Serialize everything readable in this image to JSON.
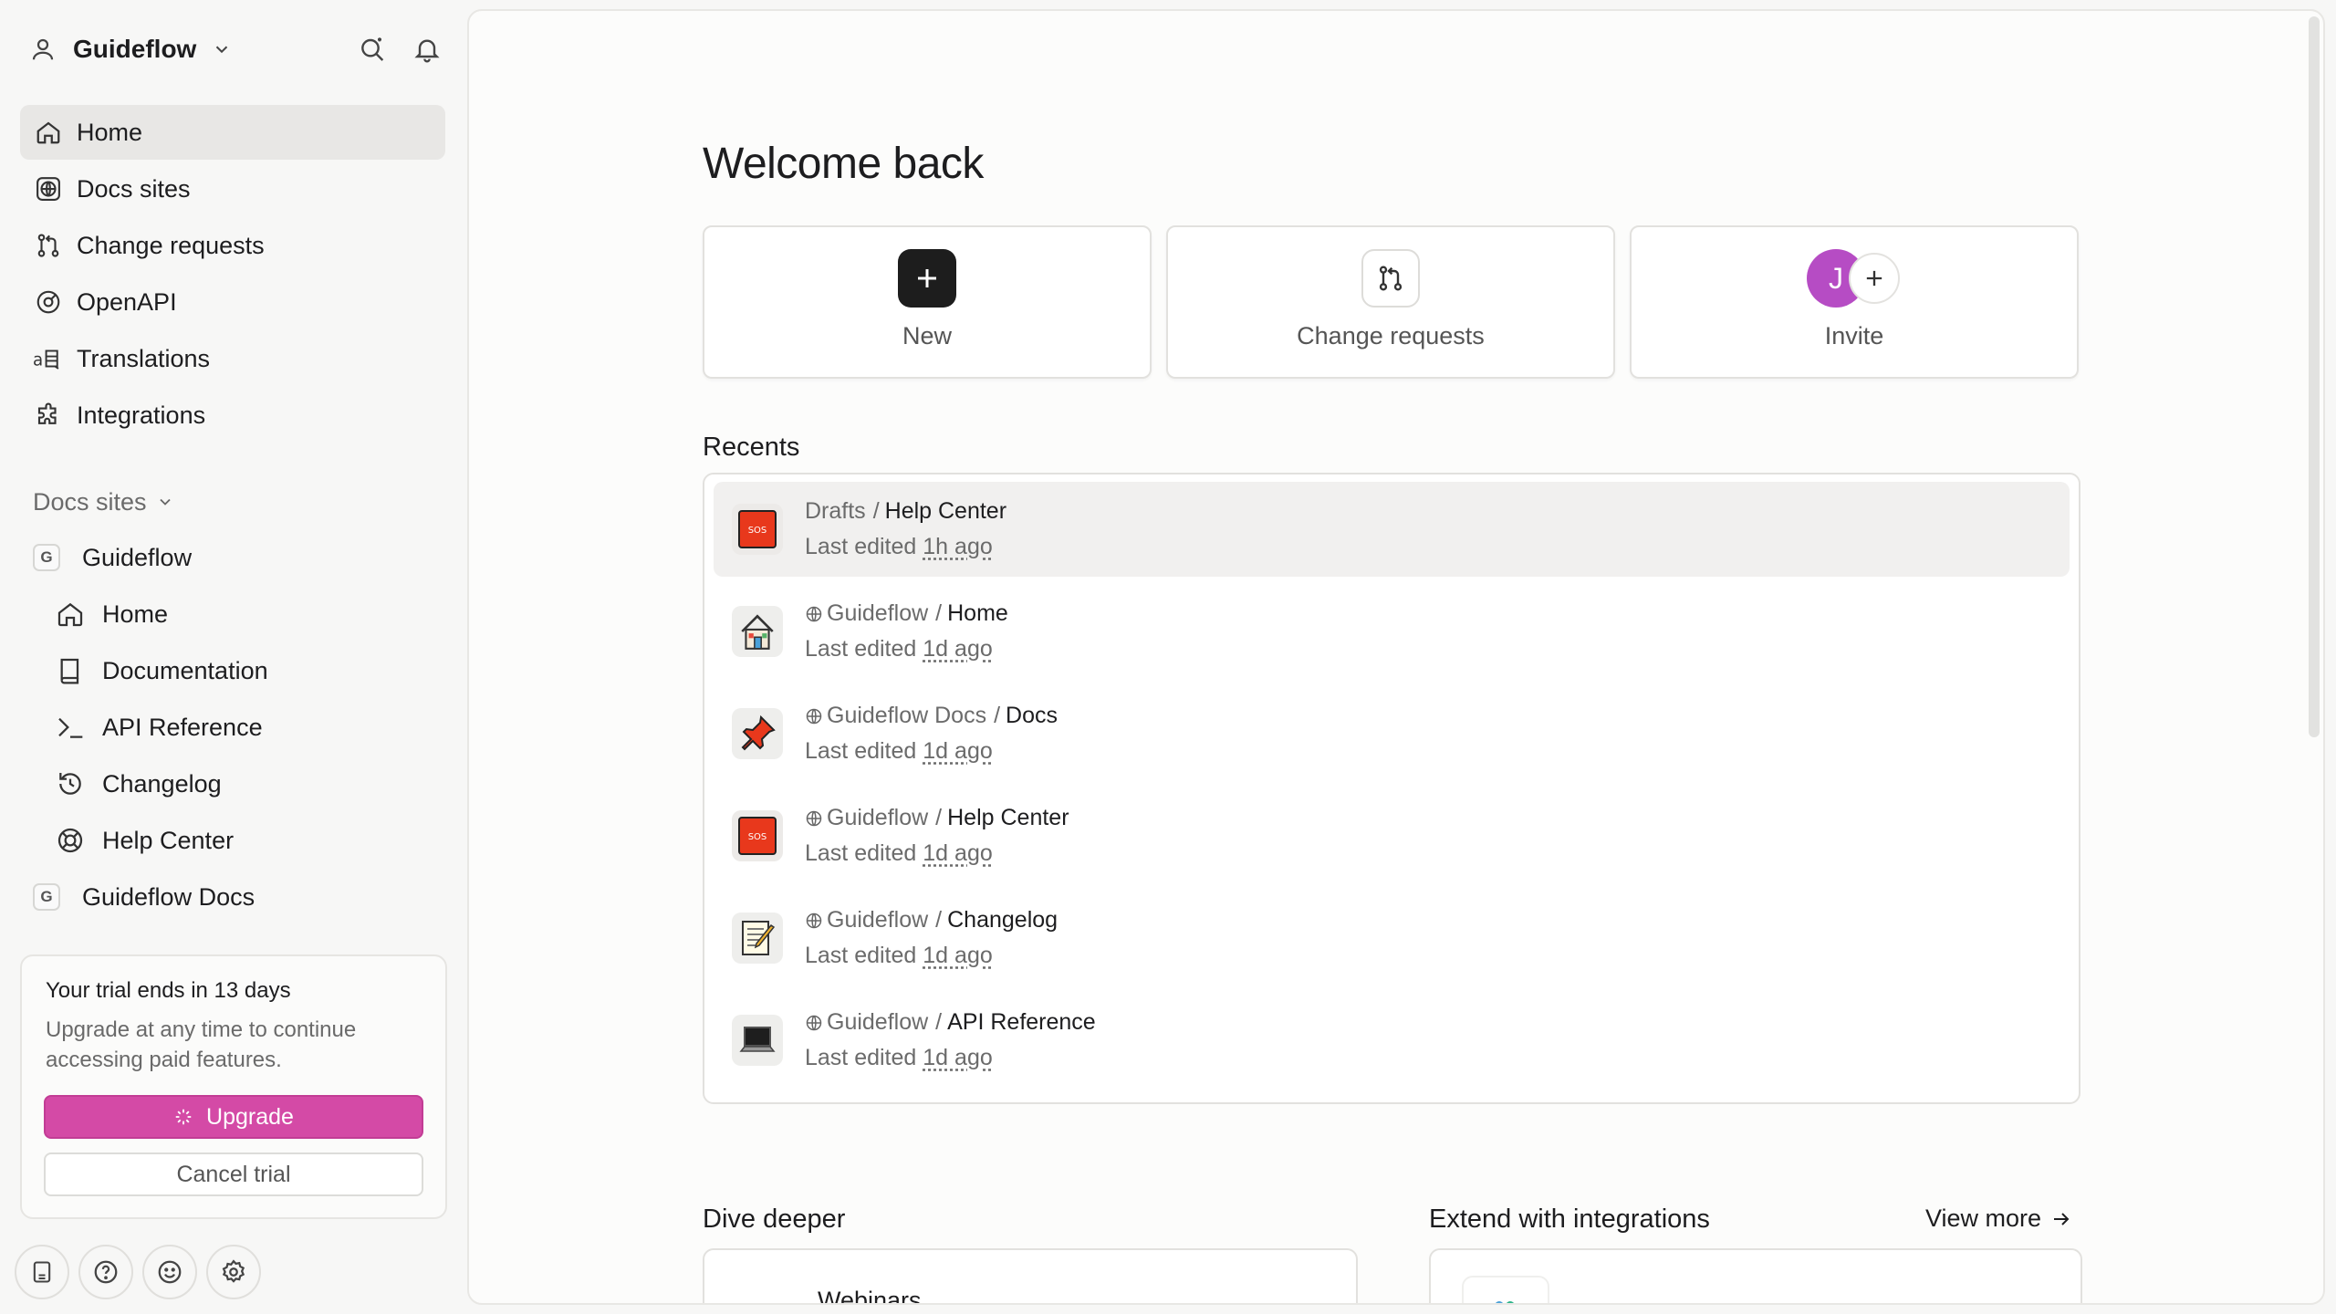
{
  "workspace": {
    "name": "Guideflow"
  },
  "nav": [
    {
      "label": "Home",
      "icon": "home-icon",
      "active": true
    },
    {
      "label": "Docs sites",
      "icon": "globe-icon"
    },
    {
      "label": "Change requests",
      "icon": "git-pull-icon"
    },
    {
      "label": "OpenAPI",
      "icon": "openapi-icon"
    },
    {
      "label": "Translations",
      "icon": "translate-icon"
    },
    {
      "label": "Integrations",
      "icon": "puzzle-icon"
    }
  ],
  "sites_section": {
    "label": "Docs sites",
    "site1": {
      "badge": "G",
      "name": "Guideflow"
    },
    "subpages": [
      {
        "label": "Home",
        "icon": "home-icon"
      },
      {
        "label": "Documentation",
        "icon": "book-icon"
      },
      {
        "label": "API Reference",
        "icon": "terminal-icon"
      },
      {
        "label": "Changelog",
        "icon": "history-icon"
      },
      {
        "label": "Help Center",
        "icon": "lifebuoy-icon"
      }
    ],
    "site2": {
      "badge": "G",
      "name": "Guideflow Docs"
    }
  },
  "trial": {
    "title": "Your trial ends in 13 days",
    "description": "Upgrade at any time to continue accessing paid features.",
    "upgrade_label": "Upgrade",
    "cancel_label": "Cancel trial"
  },
  "main": {
    "welcome": "Welcome back",
    "actions": {
      "new": "New",
      "change_requests": "Change requests",
      "invite": "Invite",
      "invite_avatar": "J"
    },
    "recents_title": "Recents",
    "recents": [
      {
        "space": "Drafts",
        "sep": "/",
        "page": "Help Center",
        "meta_prefix": "Last edited",
        "ago": "1h ago",
        "globe": false,
        "emoji": "sos"
      },
      {
        "space": "Guideflow",
        "sep": "/",
        "page": "Home",
        "meta_prefix": "Last edited",
        "ago": "1d ago",
        "globe": true,
        "emoji": "house"
      },
      {
        "space": "Guideflow Docs",
        "sep": "/",
        "page": "Docs",
        "meta_prefix": "Last edited",
        "ago": "1d ago",
        "globe": true,
        "emoji": "pushpin"
      },
      {
        "space": "Guideflow",
        "sep": "/",
        "page": "Help Center",
        "meta_prefix": "Last edited",
        "ago": "1d ago",
        "globe": true,
        "emoji": "sos"
      },
      {
        "space": "Guideflow",
        "sep": "/",
        "page": "Changelog",
        "meta_prefix": "Last edited",
        "ago": "1d ago",
        "globe": true,
        "emoji": "memo"
      },
      {
        "space": "Guideflow",
        "sep": "/",
        "page": "API Reference",
        "meta_prefix": "Last edited",
        "ago": "1d ago",
        "globe": true,
        "emoji": "laptop"
      }
    ],
    "dive_deeper_title": "Dive deeper",
    "dive_deeper_card": "Webinars",
    "integrations_title": "Extend with integrations",
    "view_more": "View more"
  },
  "colors": {
    "accent": "#d44aa6",
    "avatar": "#b64cc4",
    "sos": "#e8381c"
  }
}
